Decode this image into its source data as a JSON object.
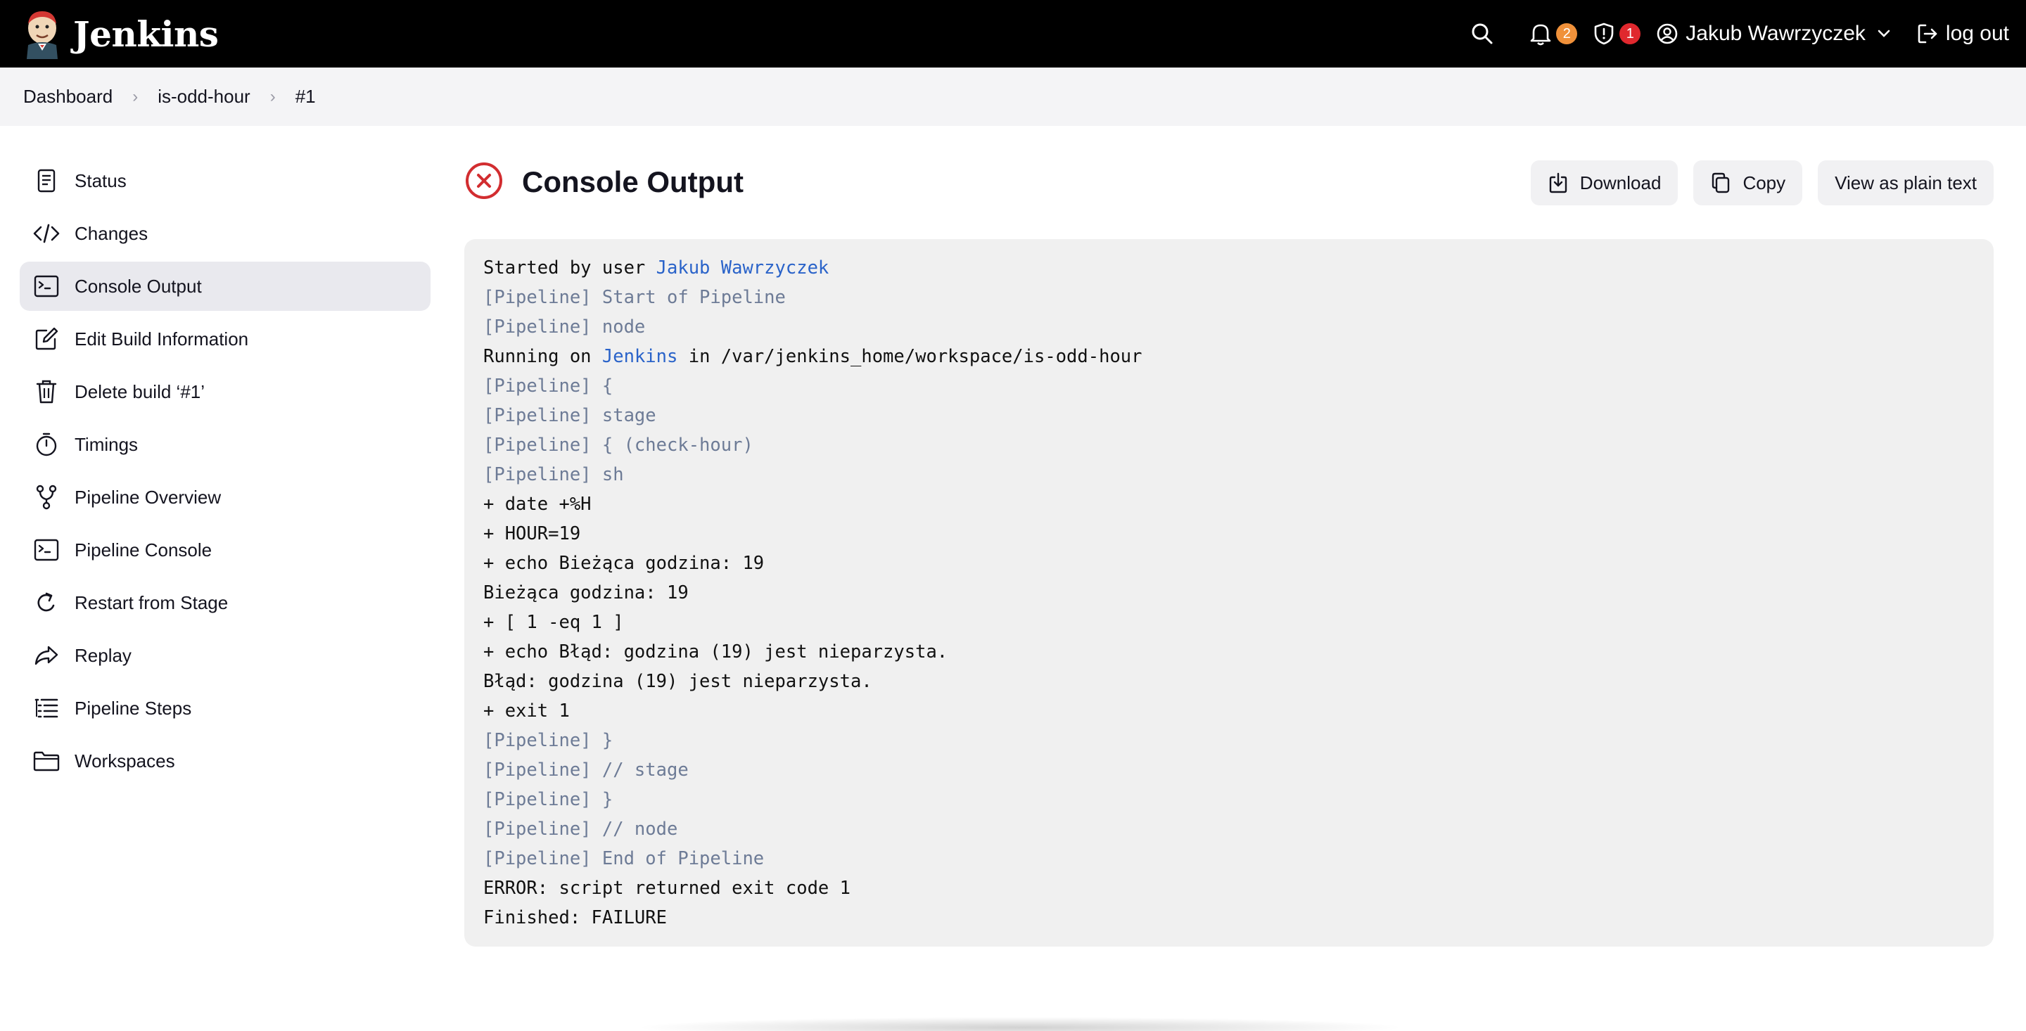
{
  "header": {
    "brand": "Jenkins",
    "notifications_count": "2",
    "security_count": "1",
    "user_name": "Jakub Wawrzyczek",
    "logout": "log out"
  },
  "breadcrumb": [
    "Dashboard",
    "is-odd-hour",
    "#1"
  ],
  "sidebar": {
    "items": [
      {
        "label": "Status",
        "icon": "document-icon"
      },
      {
        "label": "Changes",
        "icon": "code-icon"
      },
      {
        "label": "Console Output",
        "icon": "terminal-icon",
        "active": true
      },
      {
        "label": "Edit Build Information",
        "icon": "edit-icon"
      },
      {
        "label": "Delete build ‘#1’",
        "icon": "trash-icon"
      },
      {
        "label": "Timings",
        "icon": "stopwatch-icon"
      },
      {
        "label": "Pipeline Overview",
        "icon": "branch-icon"
      },
      {
        "label": "Pipeline Console",
        "icon": "terminal-icon"
      },
      {
        "label": "Restart from Stage",
        "icon": "restart-icon"
      },
      {
        "label": "Replay",
        "icon": "replay-icon"
      },
      {
        "label": "Pipeline Steps",
        "icon": "list-icon"
      },
      {
        "label": "Workspaces",
        "icon": "folder-icon"
      }
    ]
  },
  "main": {
    "title": "Console Output",
    "status": "failure",
    "actions": {
      "download": "Download",
      "copy": "Copy",
      "plain_text": "View as plain text"
    }
  },
  "console": {
    "started_prefix": "Started by user ",
    "started_user": "Jakub Wawrzyczek",
    "running_prefix": "Running on ",
    "running_node": "Jenkins",
    "running_suffix": " in /var/jenkins_home/workspace/is-odd-hour",
    "lines": [
      {
        "text": "[Pipeline] Start of Pipeline",
        "type": "pipe"
      },
      {
        "text": "[Pipeline] node",
        "type": "pipe"
      },
      {
        "text": "__RUNNING__",
        "type": "run"
      },
      {
        "text": "[Pipeline] {",
        "type": "pipe"
      },
      {
        "text": "[Pipeline] stage",
        "type": "pipe"
      },
      {
        "text": "[Pipeline] { (check-hour)",
        "type": "pipe"
      },
      {
        "text": "[Pipeline] sh",
        "type": "pipe"
      },
      {
        "text": "+ date +%H",
        "type": "out"
      },
      {
        "text": "+ HOUR=19",
        "type": "out"
      },
      {
        "text": "+ echo Bieżąca godzina: 19",
        "type": "out"
      },
      {
        "text": "Bieżąca godzina: 19",
        "type": "out"
      },
      {
        "text": "+ [ 1 -eq 1 ]",
        "type": "out"
      },
      {
        "text": "+ echo Błąd: godzina (19) jest nieparzysta.",
        "type": "out"
      },
      {
        "text": "Błąd: godzina (19) jest nieparzysta.",
        "type": "out"
      },
      {
        "text": "+ exit 1",
        "type": "out"
      },
      {
        "text": "[Pipeline] }",
        "type": "pipe"
      },
      {
        "text": "[Pipeline] // stage",
        "type": "pipe"
      },
      {
        "text": "[Pipeline] }",
        "type": "pipe"
      },
      {
        "text": "[Pipeline] // node",
        "type": "pipe"
      },
      {
        "text": "[Pipeline] End of Pipeline",
        "type": "pipe"
      },
      {
        "text": "ERROR: script returned exit code 1",
        "type": "out"
      },
      {
        "text": "Finished: FAILURE",
        "type": "out"
      }
    ]
  },
  "colors": {
    "header_bg": "#000000",
    "breadcrumb_bg": "#f4f4f6",
    "console_bg": "#f0f0f0",
    "pipeline_text": "#6d7b96",
    "link": "#2a63c9",
    "failure": "#d22d30",
    "badge_orange": "#f0913a",
    "badge_red": "#e0282e"
  }
}
